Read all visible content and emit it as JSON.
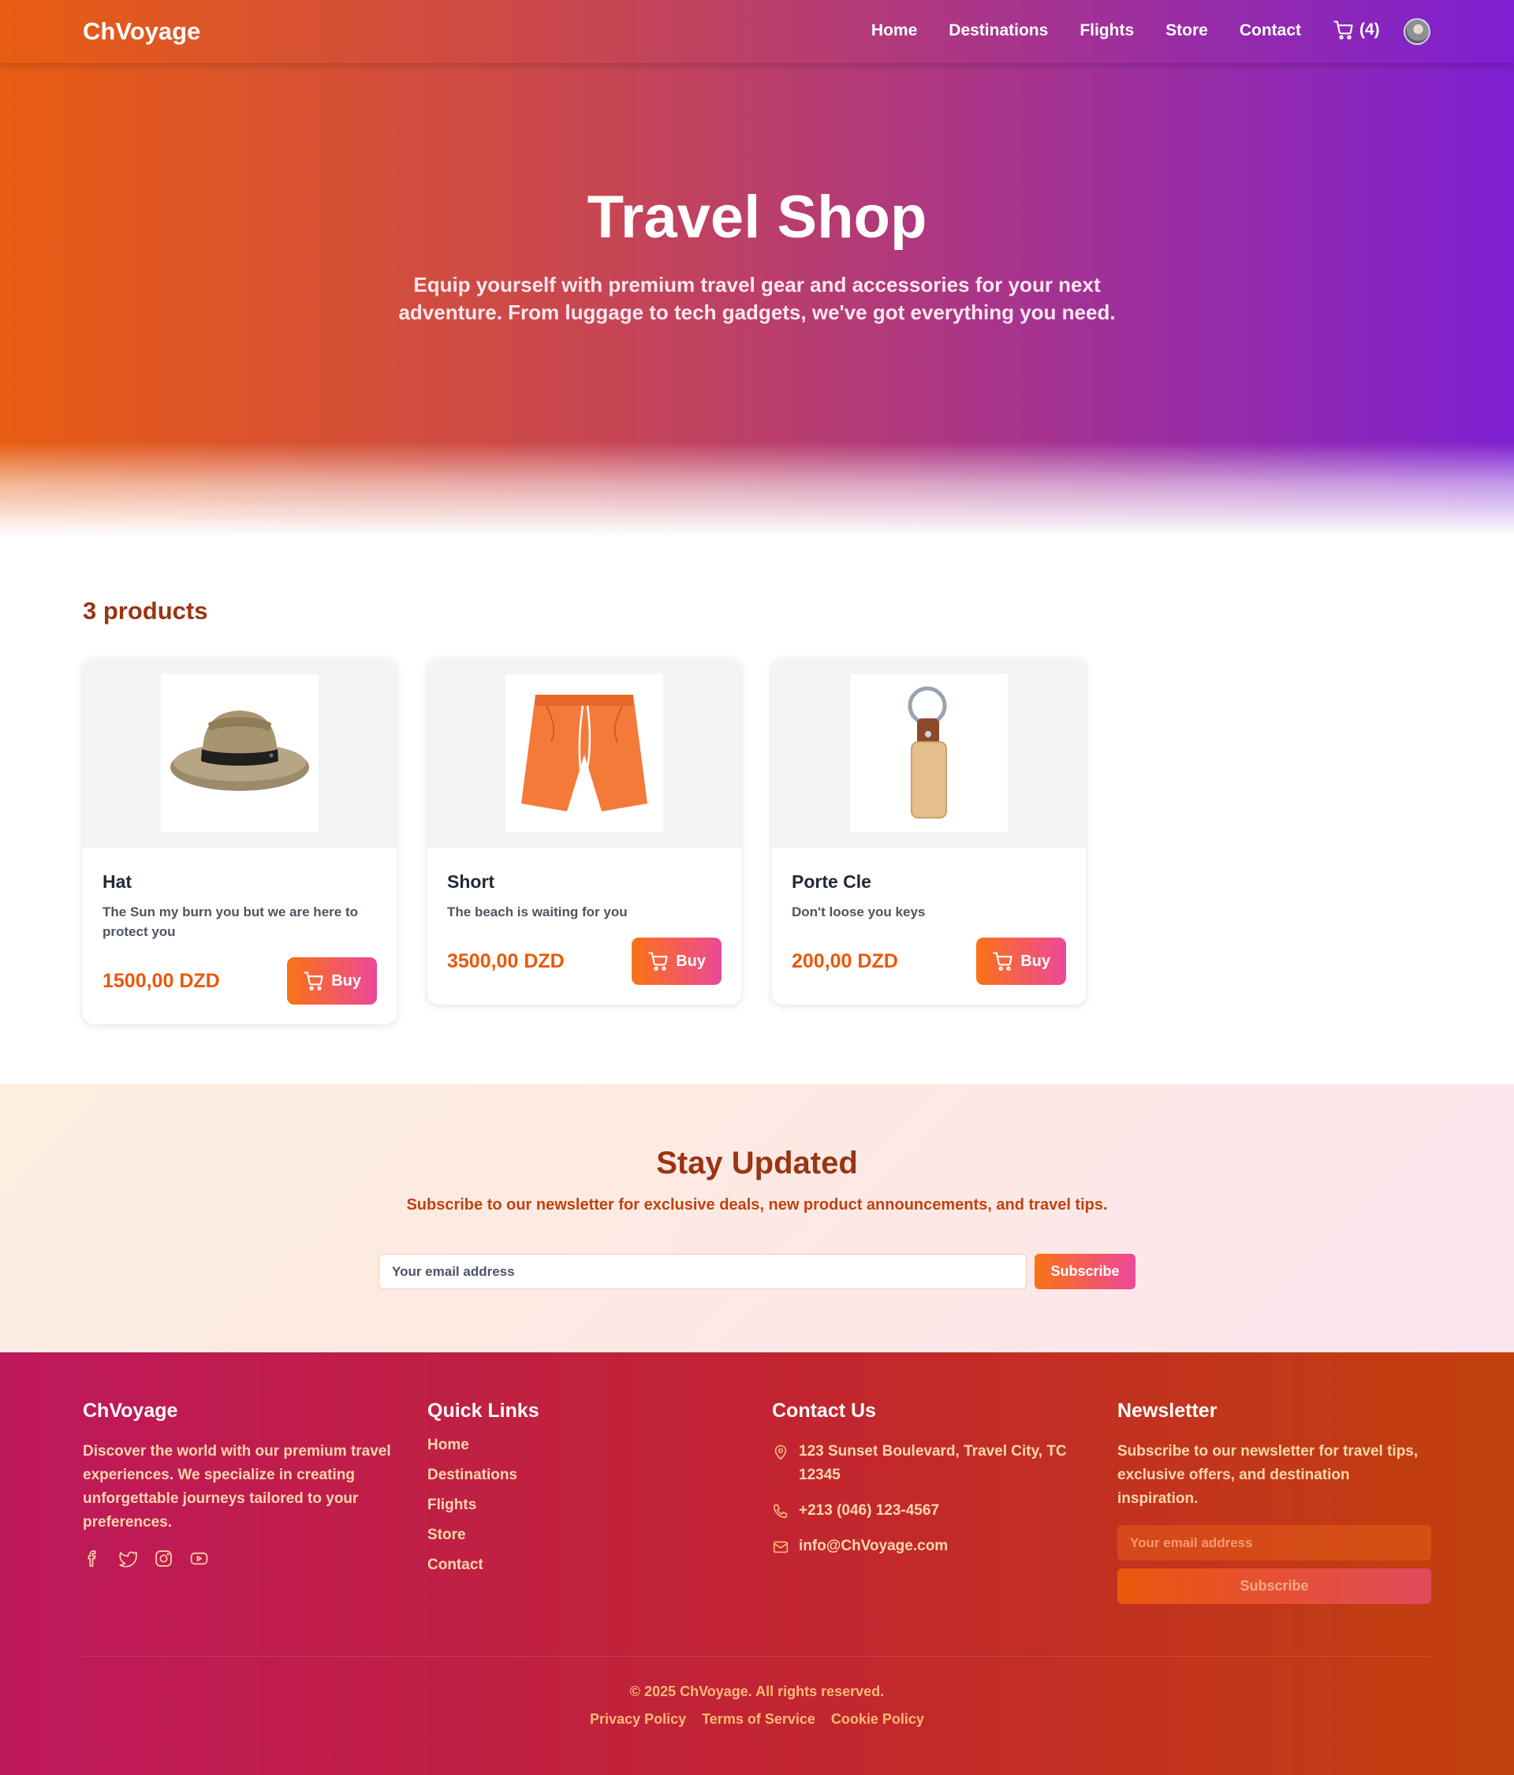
{
  "brand": "ChVoyage",
  "nav": {
    "links": [
      "Home",
      "Destinations",
      "Flights",
      "Store",
      "Contact"
    ],
    "cart_count": "(4)"
  },
  "hero": {
    "title": "Travel Shop",
    "subtitle": "Equip yourself with premium travel gear and accessories for your next adventure. From luggage to tech gadgets, we've got everything you need."
  },
  "products": {
    "count_label": "3 products",
    "buy_label": "Buy",
    "items": [
      {
        "name": "Hat",
        "description": "The Sun my burn you but we are here to protect you",
        "price": "1500,00 DZD"
      },
      {
        "name": "Short",
        "description": "The beach is waiting for you",
        "price": "3500,00 DZD"
      },
      {
        "name": "Porte Cle",
        "description": "Don't loose you keys",
        "price": "200,00 DZD"
      }
    ]
  },
  "newsletter": {
    "title": "Stay Updated",
    "subtitle": "Subscribe to our newsletter for exclusive deals, new product announcements, and travel tips.",
    "placeholder": "Your email address",
    "button": "Subscribe"
  },
  "footer": {
    "brand": "ChVoyage",
    "about": "Discover the world with our premium travel experiences. We specialize in creating unforgettable journeys tailored to your preferences.",
    "socials": [
      "facebook-icon",
      "twitter-icon",
      "instagram-icon",
      "youtube-icon"
    ],
    "quick_links_title": "Quick Links",
    "quick_links": [
      "Home",
      "Destinations",
      "Flights",
      "Store",
      "Contact"
    ],
    "contact_title": "Contact Us",
    "address": "123 Sunset Boulevard, Travel City, TC 12345",
    "phone": "+213 (046) 123-4567",
    "email": "info@ChVoyage.com",
    "newsletter_title": "Newsletter",
    "newsletter_text": "Subscribe to our newsletter for travel tips, exclusive offers, and destination inspiration.",
    "newsletter_placeholder": "Your email address",
    "newsletter_button": "Subscribe",
    "copyright": "© 2025 ChVoyage. All rights reserved.",
    "legal": [
      "Privacy Policy",
      "Terms of Service",
      "Cookie Policy"
    ]
  },
  "colors": {
    "accent_orange": "#f97316",
    "accent_pink": "#ec4899",
    "hero_purple": "#7d1fd2",
    "price": "#ea580c",
    "heading_brown": "#9a3412"
  }
}
